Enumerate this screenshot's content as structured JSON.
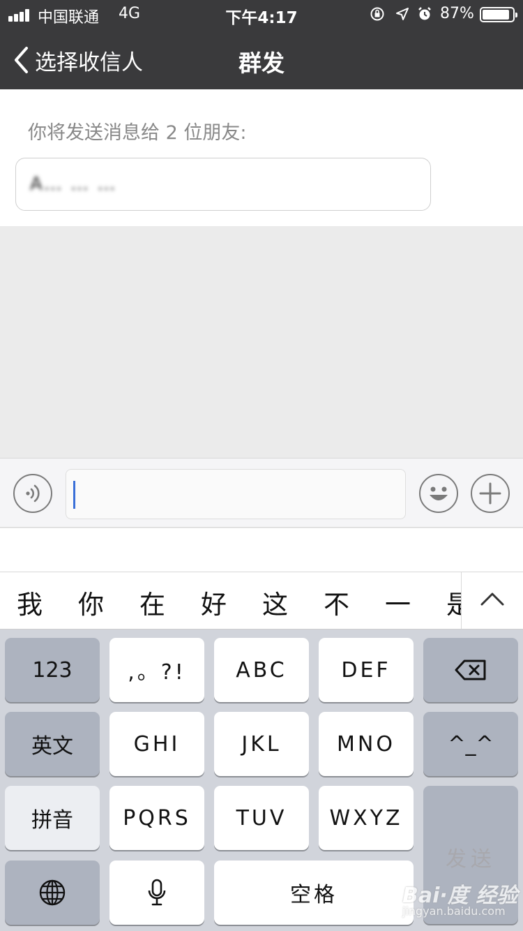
{
  "status_bar": {
    "carrier": "中国联通",
    "network": "4G",
    "time": "下午4:17",
    "battery_percent": "87%",
    "battery_level": 0.87,
    "icons": [
      "signal-icon",
      "orientation-lock-icon",
      "location-icon",
      "alarm-icon",
      "battery-icon"
    ]
  },
  "nav": {
    "back_label": "选择收信人",
    "title": "群发"
  },
  "recipients": {
    "intro": "你将发送消息给 2 位朋友:",
    "names_blurred": "A… … …"
  },
  "input_bar": {
    "value": "",
    "left_icon": "voice-icon",
    "right_icons": [
      "emoji-icon",
      "plus-icon"
    ]
  },
  "candidates": [
    "我",
    "你",
    "在",
    "好",
    "这",
    "不",
    "一",
    "是"
  ],
  "keyboard": {
    "row1": {
      "func": "123",
      "keys": [
        ",。?!",
        "ABC",
        "DEF"
      ],
      "action_icon": "backspace-icon"
    },
    "row2": {
      "func": "英文",
      "keys": [
        "GHI",
        "JKL",
        "MNO"
      ],
      "action": "^_^"
    },
    "row3": {
      "func": "拼音",
      "keys": [
        "PQRS",
        "TUV",
        "WXYZ"
      ],
      "action": "发送"
    },
    "row4": {
      "globe_icon": "globe-icon",
      "mic_icon": "microphone-icon",
      "space": "空格"
    }
  },
  "watermark": {
    "main": "Bai·度 经验",
    "sub": "jingyan.baidu.com"
  },
  "colors": {
    "nav_bg": "#3a3a3c",
    "content_bg": "#ebebeb",
    "keyboard_bg": "#d1d4db",
    "func_key": "#adb3bf",
    "caret": "#3a6fd8"
  }
}
